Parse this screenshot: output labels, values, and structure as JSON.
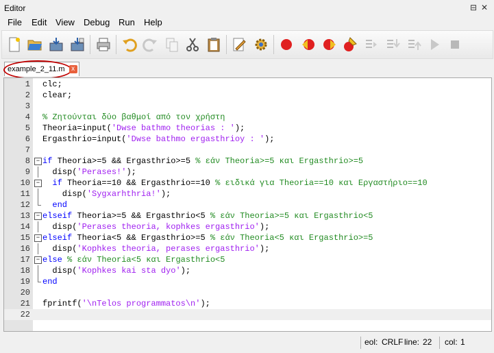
{
  "window": {
    "title": "Editor",
    "controls": [
      "⊟",
      "✕"
    ]
  },
  "menu": [
    {
      "label": "File"
    },
    {
      "label": "Edit"
    },
    {
      "label": "View"
    },
    {
      "label": "Debug"
    },
    {
      "label": "Run"
    },
    {
      "label": "Help"
    }
  ],
  "toolbar": [
    "new-file-icon",
    "open-folder-icon",
    "save-icon",
    "save-as-icon",
    "print-icon",
    "undo-icon",
    "redo-icon",
    "copy-icon",
    "cut-icon",
    "paste-icon",
    "find-icon",
    "settings-gear-icon",
    "breakpoint-icon",
    "remove-breakpoint-icon",
    "next-breakpoint-icon",
    "clear-breakpoints-icon",
    "step-icon",
    "step-in-icon",
    "step-out-icon",
    "continue-icon",
    "stop-icon"
  ],
  "tab": {
    "filename": "example_2_11.m",
    "close": "x"
  },
  "code_lines": [
    [
      {
        "t": "clc;",
        "c": ""
      }
    ],
    [
      {
        "t": "clear;",
        "c": ""
      }
    ],
    [],
    [
      {
        "t": "% Ζητούνται δύο βαθμοί από τον χρήστη",
        "c": "cm"
      }
    ],
    [
      {
        "t": "Theoria=input(",
        "c": ""
      },
      {
        "t": "'Dwse bathmo theorias : '",
        "c": "str"
      },
      {
        "t": ");",
        "c": ""
      }
    ],
    [
      {
        "t": "Ergasthrio=input(",
        "c": ""
      },
      {
        "t": "'Dwse bathmo ergasthrioy : '",
        "c": "str"
      },
      {
        "t": ");",
        "c": ""
      }
    ],
    [],
    [
      {
        "t": "if",
        "c": "kw"
      },
      {
        "t": " Theoria>=5 && Ergasthrio>=5 ",
        "c": ""
      },
      {
        "t": "% εάν Theoria>=5 και Ergasthrio>=5",
        "c": "cm"
      }
    ],
    [
      {
        "t": "  disp(",
        "c": ""
      },
      {
        "t": "'Perases!'",
        "c": "str"
      },
      {
        "t": ");",
        "c": ""
      }
    ],
    [
      {
        "t": "  ",
        "c": ""
      },
      {
        "t": "if",
        "c": "kw"
      },
      {
        "t": " Theoria==10 && Ergasthrio==10 ",
        "c": ""
      },
      {
        "t": "% ειδικά για Theoria==10 και Εργαστήριο==10",
        "c": "cm"
      }
    ],
    [
      {
        "t": "    disp(",
        "c": ""
      },
      {
        "t": "'Sygxarhthria!'",
        "c": "str"
      },
      {
        "t": ");",
        "c": ""
      }
    ],
    [
      {
        "t": "  ",
        "c": ""
      },
      {
        "t": "end",
        "c": "kw"
      }
    ],
    [
      {
        "t": "elseif",
        "c": "kw"
      },
      {
        "t": " Theoria>=5 && Ergasthrio<5 ",
        "c": ""
      },
      {
        "t": "% εάν Theoria>=5 και Ergasthrio<5",
        "c": "cm"
      }
    ],
    [
      {
        "t": "  disp(",
        "c": ""
      },
      {
        "t": "'Perases theoria, kophkes ergasthrio'",
        "c": "str"
      },
      {
        "t": ");",
        "c": ""
      }
    ],
    [
      {
        "t": "elseif",
        "c": "kw"
      },
      {
        "t": " Theoria<5 && Ergasthrio>=5 ",
        "c": ""
      },
      {
        "t": "% εάν Theoria<5 και Ergasthrio>=5",
        "c": "cm"
      }
    ],
    [
      {
        "t": "  disp(",
        "c": ""
      },
      {
        "t": "'Kophkes theoria, perases ergasthrio'",
        "c": "str"
      },
      {
        "t": ");",
        "c": ""
      }
    ],
    [
      {
        "t": "else",
        "c": "kw"
      },
      {
        "t": " ",
        "c": ""
      },
      {
        "t": "% εάν Theoria<5 και Ergasthrio<5",
        "c": "cm"
      }
    ],
    [
      {
        "t": "  disp(",
        "c": ""
      },
      {
        "t": "'Kophkes kai sta dyo'",
        "c": "str"
      },
      {
        "t": ");",
        "c": ""
      }
    ],
    [
      {
        "t": "end",
        "c": "kw"
      }
    ],
    [],
    [
      {
        "t": "fprintf(",
        "c": ""
      },
      {
        "t": "'\\nTelos programmatos\\n'",
        "c": "str"
      },
      {
        "t": ");",
        "c": ""
      }
    ],
    []
  ],
  "folds": {
    "8": "box",
    "9": "line",
    "10": "box",
    "11": "line",
    "12": "end",
    "13": "box",
    "14": "line",
    "15": "box",
    "16": "line",
    "17": "box",
    "18": "line",
    "19": "end"
  },
  "current_line": 22,
  "status": {
    "eol_label": "eol:",
    "eol_value": "CRLF",
    "line_label": "line:",
    "line_value": "22",
    "col_label": "col:",
    "col_value": "1"
  },
  "colors": {
    "keyword": "#0000ff",
    "string": "#a020f0",
    "comment": "#228b22",
    "tab_highlight": "#c00000"
  }
}
